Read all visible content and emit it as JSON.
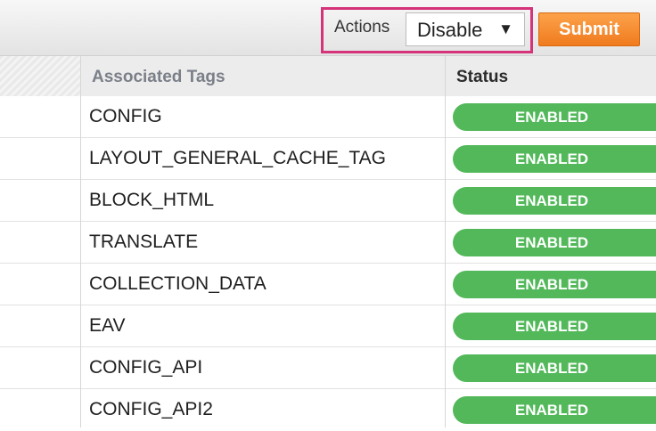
{
  "toolbar": {
    "actions_label": "Actions",
    "actions_selected": "Disable",
    "submit_label": "Submit"
  },
  "table": {
    "columns": [
      "Associated Tags",
      "Status"
    ],
    "rows": [
      {
        "tag": "CONFIG",
        "status": "ENABLED"
      },
      {
        "tag": "LAYOUT_GENERAL_CACHE_TAG",
        "status": "ENABLED"
      },
      {
        "tag": "BLOCK_HTML",
        "status": "ENABLED"
      },
      {
        "tag": "TRANSLATE",
        "status": "ENABLED"
      },
      {
        "tag": "COLLECTION_DATA",
        "status": "ENABLED"
      },
      {
        "tag": "EAV",
        "status": "ENABLED"
      },
      {
        "tag": "CONFIG_API",
        "status": "ENABLED"
      },
      {
        "tag": "CONFIG_API2",
        "status": "ENABLED"
      }
    ]
  },
  "colors": {
    "highlight_border": "#d5337a",
    "submit_button": "#f08a24",
    "status_enabled": "#52b85a"
  }
}
